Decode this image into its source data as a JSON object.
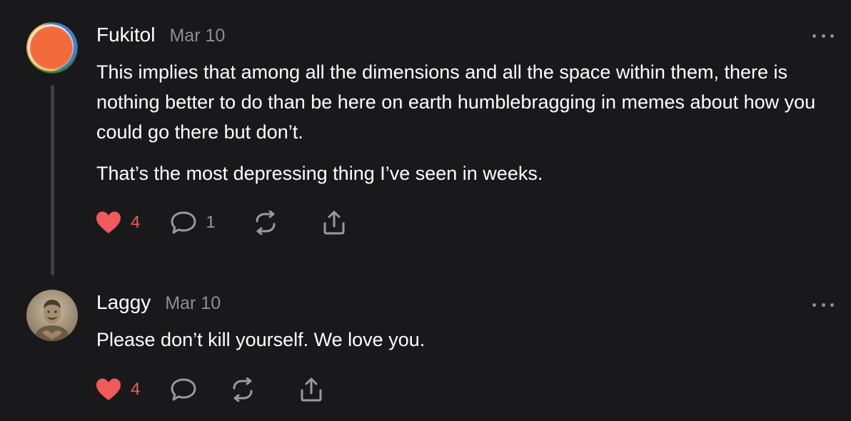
{
  "comments": [
    {
      "author": "Fukitol",
      "date": "Mar 10",
      "paragraphs": [
        "This implies that among all the dimensions and all the space within them, there is nothing better to do than be here on earth humblebragging in memes about how you could go there but don’t.",
        "That’s the most depressing thing I’ve seen in weeks."
      ],
      "likes": "4",
      "replies": "1",
      "avatar_icon": "orange-circle-avatar"
    },
    {
      "author": "Laggy",
      "date": "Mar 10",
      "paragraphs": [
        "Please don’t kill yourself. We love you."
      ],
      "likes": "4",
      "replies": "",
      "avatar_icon": "sepia-photo-avatar"
    }
  ],
  "icons": {
    "like": "heart-icon",
    "reply": "comment-bubble-icon",
    "restack": "restack-icon",
    "share": "share-icon",
    "more": "more-options-icon"
  },
  "colors": {
    "background": "#19191b",
    "like_active": "#f05a5a",
    "muted": "#8e8e93"
  }
}
